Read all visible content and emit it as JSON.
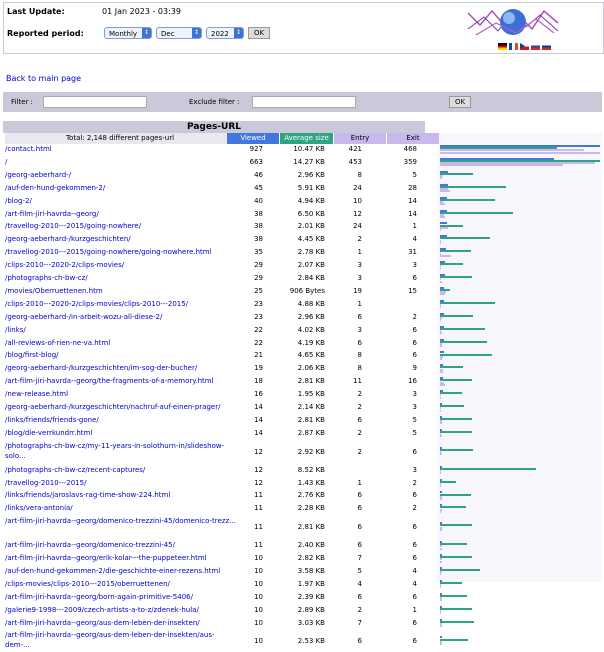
{
  "header": {
    "last_update_label": "Last Update:",
    "last_update_value": "01 Jan 2023 - 03:39",
    "reported_period_label": "Reported period:",
    "period_type": "Monthly",
    "month": "Dec",
    "year": "2022",
    "ok_label": "OK"
  },
  "back_link": "Back to main page",
  "filter": {
    "filter_label": "Filter :",
    "exclude_label": "Exclude filter :",
    "filter_value": "",
    "exclude_value": "",
    "ok_label": "OK"
  },
  "table": {
    "title": "Pages-URL",
    "total_label": "Total: 2,148 different pages-url",
    "columns": [
      "Viewed",
      "Average size",
      "Entry",
      "Exit"
    ],
    "colors": {
      "viewed": "#4477dd",
      "avgsize": "#2ea485",
      "entry": "#c8b8ec",
      "exit": "#c8b8ec",
      "title_bg": "#c9c9d9"
    },
    "rows": [
      {
        "url": "/contact.html",
        "viewed": "927",
        "size": "10.47 KB",
        "entry": "421",
        "exit": "468",
        "v": 927,
        "s": 10.47,
        "en": 421,
        "ex": 468
      },
      {
        "url": "/",
        "viewed": "663",
        "size": "14.27 KB",
        "entry": "453",
        "exit": "359",
        "v": 663,
        "s": 14.27,
        "en": 453,
        "ex": 359
      },
      {
        "url": "/georg-aeberhard-/",
        "viewed": "46",
        "size": "2.96 KB",
        "entry": "8",
        "exit": "5",
        "v": 46,
        "s": 2.96,
        "en": 8,
        "ex": 5
      },
      {
        "url": "/auf-den-hund-gekommen-2/",
        "viewed": "45",
        "size": "5.91 KB",
        "entry": "24",
        "exit": "28",
        "v": 45,
        "s": 5.91,
        "en": 24,
        "ex": 28
      },
      {
        "url": "/blog-2/",
        "viewed": "40",
        "size": "4.94 KB",
        "entry": "10",
        "exit": "14",
        "v": 40,
        "s": 4.94,
        "en": 10,
        "ex": 14
      },
      {
        "url": "/art-film-jiri-havrda--georg/",
        "viewed": "38",
        "size": "6.50 KB",
        "entry": "12",
        "exit": "14",
        "v": 38,
        "s": 6.5,
        "en": 12,
        "ex": 14
      },
      {
        "url": "/travellog-2010---2015/going-nowhere/",
        "viewed": "38",
        "size": "2.01 KB",
        "entry": "24",
        "exit": "1",
        "v": 38,
        "s": 2.01,
        "en": 24,
        "ex": 1
      },
      {
        "url": "/georg-aeberhard-/kurzgeschichten/",
        "viewed": "38",
        "size": "4.45 KB",
        "entry": "2",
        "exit": "4",
        "v": 38,
        "s": 4.45,
        "en": 2,
        "ex": 4
      },
      {
        "url": "/travellog-2010---2015/going-nowhere/going-nowhere.html",
        "viewed": "35",
        "size": "2.78 KB",
        "entry": "1",
        "exit": "31",
        "v": 35,
        "s": 2.78,
        "en": 1,
        "ex": 31
      },
      {
        "url": "/clips-2010---2020-2/clips-movies/",
        "viewed": "29",
        "size": "2.07 KB",
        "entry": "3",
        "exit": "3",
        "v": 29,
        "s": 2.07,
        "en": 3,
        "ex": 3
      },
      {
        "url": "/photographs-ch-bw-cz/",
        "viewed": "29",
        "size": "2.84 KB",
        "entry": "3",
        "exit": "6",
        "v": 29,
        "s": 2.84,
        "en": 3,
        "ex": 6
      },
      {
        "url": "/movies/Oberruettenen.htm",
        "viewed": "25",
        "size": "906 Bytes",
        "entry": "19",
        "exit": "15",
        "v": 25,
        "s": 0.88,
        "en": 19,
        "ex": 15
      },
      {
        "url": "/clips-2010---2020-2/clips-movies/clips-2010---2015/",
        "viewed": "23",
        "size": "4.88 KB",
        "entry": "1",
        "exit": "",
        "v": 23,
        "s": 4.88,
        "en": 1,
        "ex": 0
      },
      {
        "url": "/georg-aeberhard-/in-arbeit-wozu-all-diese-2/",
        "viewed": "23",
        "size": "2.96 KB",
        "entry": "6",
        "exit": "2",
        "v": 23,
        "s": 2.96,
        "en": 6,
        "ex": 2
      },
      {
        "url": "/links/",
        "viewed": "22",
        "size": "4.02 KB",
        "entry": "3",
        "exit": "6",
        "v": 22,
        "s": 4.02,
        "en": 3,
        "ex": 6
      },
      {
        "url": "/all-reviews-of-rien-ne-va.html",
        "viewed": "22",
        "size": "4.19 KB",
        "entry": "6",
        "exit": "6",
        "v": 22,
        "s": 4.19,
        "en": 6,
        "ex": 6
      },
      {
        "url": "/blog/first-blog/",
        "viewed": "21",
        "size": "4.65 KB",
        "entry": "8",
        "exit": "6",
        "v": 21,
        "s": 4.65,
        "en": 8,
        "ex": 6
      },
      {
        "url": "/georg-aeberhard-/kurzgeschichten/im-sog-der-bucher/",
        "viewed": "19",
        "size": "2.06 KB",
        "entry": "8",
        "exit": "9",
        "v": 19,
        "s": 2.06,
        "en": 8,
        "ex": 9
      },
      {
        "url": "/art-film-jiri-havrda--georg/the-fragments-of-a-memory.html",
        "viewed": "18",
        "size": "2.81 KB",
        "entry": "11",
        "exit": "16",
        "v": 18,
        "s": 2.81,
        "en": 11,
        "ex": 16
      },
      {
        "url": "/new-release.html",
        "viewed": "16",
        "size": "1.95 KB",
        "entry": "2",
        "exit": "3",
        "v": 16,
        "s": 1.95,
        "en": 2,
        "ex": 3
      },
      {
        "url": "/georg-aeberhard-/kurzgeschichten/nachruf-auf-einen-prager/",
        "viewed": "14",
        "size": "2.14 KB",
        "entry": "2",
        "exit": "3",
        "v": 14,
        "s": 2.14,
        "en": 2,
        "ex": 3
      },
      {
        "url": "/links/friends/friends-gone/",
        "viewed": "14",
        "size": "2.81 KB",
        "entry": "6",
        "exit": "5",
        "v": 14,
        "s": 2.81,
        "en": 6,
        "ex": 5
      },
      {
        "url": "/blog/die-verrkundrr.html",
        "viewed": "14",
        "size": "2.87 KB",
        "entry": "2",
        "exit": "5",
        "v": 14,
        "s": 2.87,
        "en": 2,
        "ex": 5
      },
      {
        "url": "/photographs-ch-bw-cz/my-11-years-in-solothurn-in/slideshow-solo...",
        "viewed": "12",
        "size": "2.92 KB",
        "entry": "2",
        "exit": "6",
        "v": 12,
        "s": 2.92,
        "en": 2,
        "ex": 6,
        "two": true
      },
      {
        "url": "/photographs-ch-bw-cz/recent-captures/",
        "viewed": "12",
        "size": "8.52 KB",
        "entry": "",
        "exit": "3",
        "v": 12,
        "s": 8.52,
        "en": 0,
        "ex": 3
      },
      {
        "url": "/travellog-2010---2015/",
        "viewed": "12",
        "size": "1.43 KB",
        "entry": "1",
        "exit": "2",
        "v": 12,
        "s": 1.43,
        "en": 1,
        "ex": 2
      },
      {
        "url": "/links/friends/jaroslavs-rag-time-show-224.html",
        "viewed": "11",
        "size": "2.76 KB",
        "entry": "6",
        "exit": "6",
        "v": 11,
        "s": 2.76,
        "en": 6,
        "ex": 6
      },
      {
        "url": "/links/vera-antonia/",
        "viewed": "11",
        "size": "2.28 KB",
        "entry": "6",
        "exit": "2",
        "v": 11,
        "s": 2.28,
        "en": 6,
        "ex": 2
      },
      {
        "url": "/art-film-jiri-havrda--georg/domenico-trezzini-45/domenico-trezz...",
        "viewed": "11",
        "size": "2.81 KB",
        "entry": "6",
        "exit": "6",
        "v": 11,
        "s": 2.81,
        "en": 6,
        "ex": 6,
        "two": true
      },
      {
        "url": "/art-film-jiri-havrda--georg/domenico-trezzini-45/",
        "viewed": "11",
        "size": "2.40 KB",
        "entry": "6",
        "exit": "6",
        "v": 11,
        "s": 2.4,
        "en": 6,
        "ex": 6
      },
      {
        "url": "/art-film-jiri-havrda--georg/erik-kolar---the-puppeteer.html",
        "viewed": "10",
        "size": "2.82 KB",
        "entry": "7",
        "exit": "6",
        "v": 10,
        "s": 2.82,
        "en": 7,
        "ex": 6
      },
      {
        "url": "/auf-den-hund-gekommen-2/die-geschichte-einer-rezens.html",
        "viewed": "10",
        "size": "3.58 KB",
        "entry": "5",
        "exit": "4",
        "v": 10,
        "s": 3.58,
        "en": 5,
        "ex": 4
      },
      {
        "url": "/clips-movies/clips-2010---2015/oberruettenen/",
        "viewed": "10",
        "size": "1.97 KB",
        "entry": "4",
        "exit": "4",
        "v": 10,
        "s": 1.97,
        "en": 4,
        "ex": 4
      },
      {
        "url": "/art-film-jiri-havrda--georg/born-again-primitive-5406/",
        "viewed": "10",
        "size": "2.39 KB",
        "entry": "6",
        "exit": "6",
        "v": 10,
        "s": 2.39,
        "en": 6,
        "ex": 6
      },
      {
        "url": "/galerie9-1998---2009/czech-artists-a-to-z/zdenek-hula/",
        "viewed": "10",
        "size": "2.89 KB",
        "entry": "2",
        "exit": "1",
        "v": 10,
        "s": 2.89,
        "en": 2,
        "ex": 1
      },
      {
        "url": "/art-film-jiri-havrda--georg/aus-dem-leben-der-insekten/",
        "viewed": "10",
        "size": "3.03 KB",
        "entry": "7",
        "exit": "6",
        "v": 10,
        "s": 3.03,
        "en": 7,
        "ex": 6
      },
      {
        "url": "/art-film-jiri-havrda--georg/aus-dem-leben-der-insekten/aus-dem-...",
        "viewed": "10",
        "size": "2.53 KB",
        "entry": "6",
        "exit": "6",
        "v": 10,
        "s": 2.53,
        "en": 6,
        "ex": 6,
        "two": true
      }
    ]
  }
}
